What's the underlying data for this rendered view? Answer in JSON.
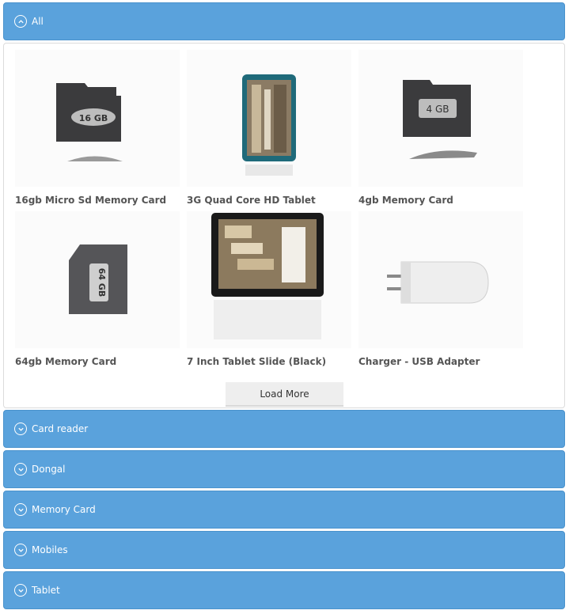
{
  "accordion": {
    "all_label": "All",
    "categories": [
      "Card reader",
      "Dongal",
      "Memory Card",
      "Mobiles",
      "Tablet"
    ]
  },
  "products": [
    {
      "name": "16gb Micro Sd Memory Card",
      "label": "16 GB"
    },
    {
      "name": "3G Quad Core HD Tablet"
    },
    {
      "name": "4gb Memory Card",
      "label": "4 GB"
    },
    {
      "name": "64gb Memory Card",
      "label": "64 GB"
    },
    {
      "name": "7 Inch Tablet Slide (Black)"
    },
    {
      "name": "Charger - USB Adapter"
    }
  ],
  "load_more_label": "Load More",
  "colors": {
    "accent": "#5aa2dc"
  }
}
